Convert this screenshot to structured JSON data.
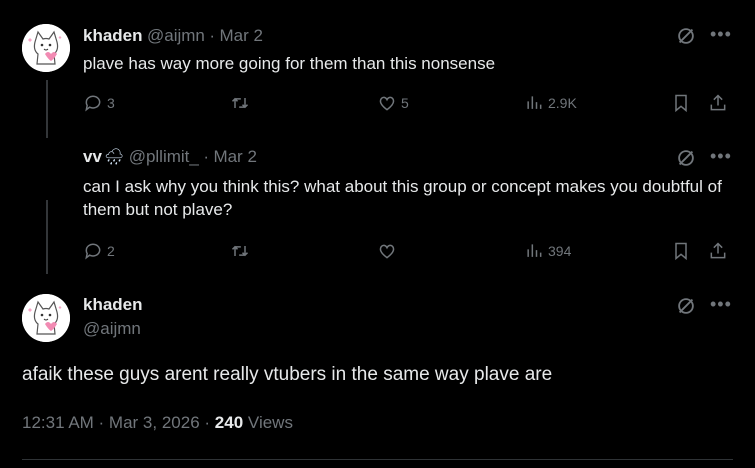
{
  "tweet1": {
    "name": "khaden",
    "handle": "@aijmn",
    "date": "Mar 2",
    "text": "plave has way more going for them than this nonsense",
    "replies": "3",
    "likes": "5",
    "views": "2.9K"
  },
  "tweet2": {
    "name": "vv",
    "name_emoji": "🌧",
    "handle": "@pllimit_",
    "date": "Mar 2",
    "text": "can I ask why you think this? what about this group or concept makes you doubtful of them but not plave?",
    "replies": "2",
    "views": "394"
  },
  "main": {
    "name": "khaden",
    "handle": "@aijmn",
    "text": "afaik these guys arent really vtubers in the same way plave are",
    "time": "12:31 AM · Mar 3, 2026",
    "views_count": "240",
    "views_label": "Views"
  },
  "separator": "·",
  "icons": {
    "reply": "reply-icon",
    "retweet": "retweet-icon",
    "like": "heart-icon",
    "views": "views-icon",
    "bookmark": "bookmark-icon",
    "share": "share-icon",
    "grok": "grok-icon",
    "more": "more-icon"
  },
  "colors": {
    "background": "#000000",
    "text": "#e7e9ea",
    "muted": "#71767b"
  }
}
